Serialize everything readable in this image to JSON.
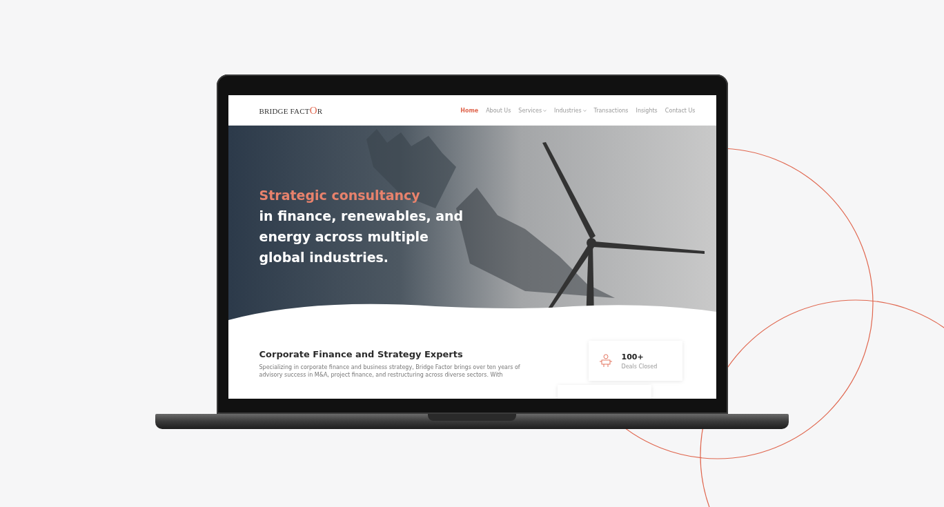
{
  "site": {
    "logo": {
      "before": "BRIDGE FACT",
      "accent": "O",
      "after": "R"
    },
    "nav": [
      {
        "label": "Home",
        "selected": true,
        "dropdown": false
      },
      {
        "label": "About Us",
        "selected": false,
        "dropdown": false
      },
      {
        "label": "Services",
        "selected": false,
        "dropdown": true
      },
      {
        "label": "Industries",
        "selected": false,
        "dropdown": true
      },
      {
        "label": "Transactions",
        "selected": false,
        "dropdown": false
      },
      {
        "label": "Insights",
        "selected": false,
        "dropdown": false
      },
      {
        "label": "Contact Us",
        "selected": false,
        "dropdown": false
      }
    ],
    "hero": {
      "heading_accent": "Strategic consultancy",
      "heading_rest": " in finance, renewables, and energy across multiple global industries."
    },
    "section": {
      "title": "Corporate Finance and Strategy Experts",
      "text": "Specializing in corporate finance and business strategy, Bridge Factor brings over ten years of advisory success in M&A, project finance, and restructuring across diverse sectors. With"
    },
    "stat": {
      "value": "100+",
      "label": "Deals Closed"
    }
  }
}
